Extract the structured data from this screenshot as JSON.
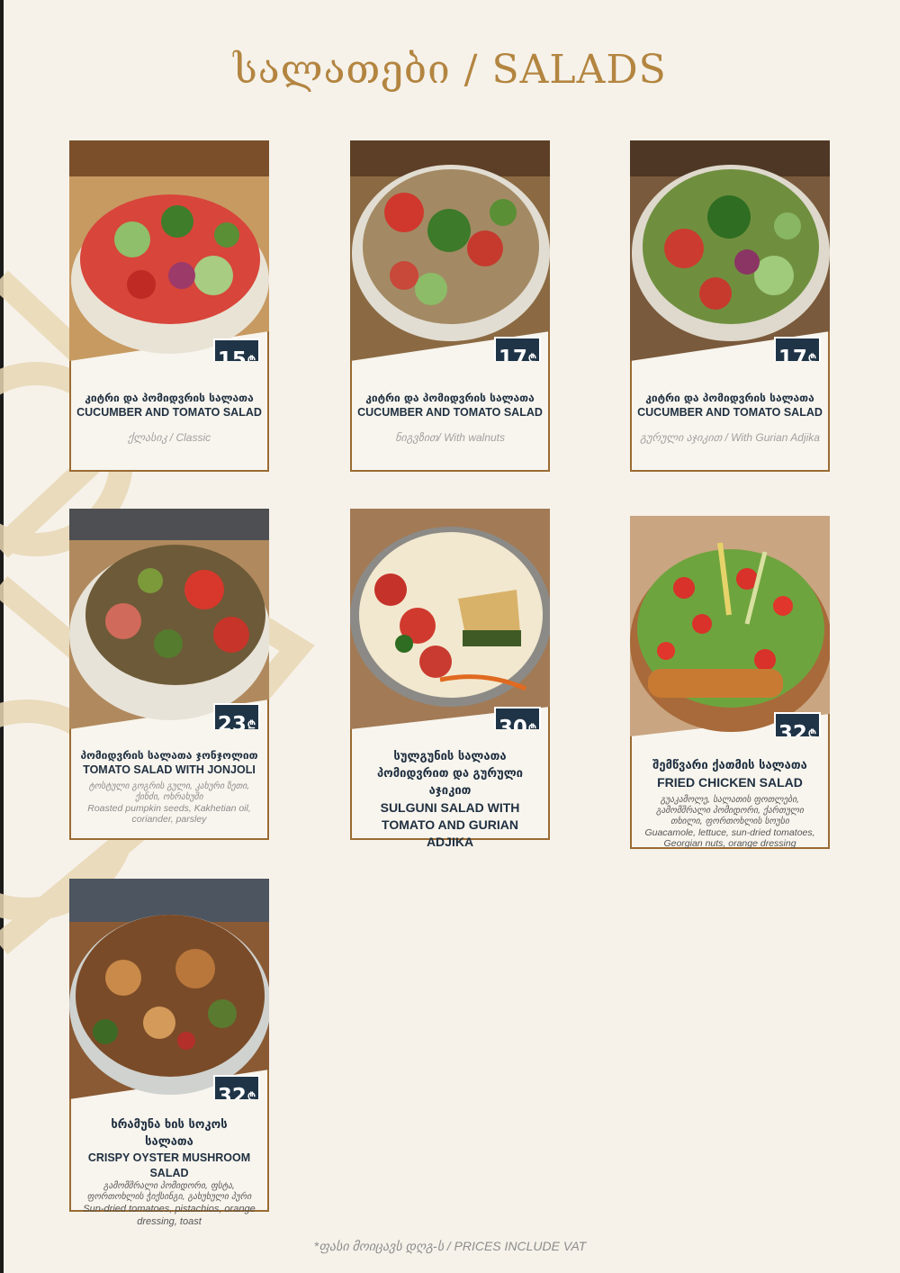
{
  "header": {
    "title": "სალათები / SALADS"
  },
  "currency_symbol": "₾",
  "colors": {
    "accent": "#b38540",
    "price_bg": "#1f3447",
    "border": "#9a6b32",
    "background": "#f6f2ea"
  },
  "items": [
    {
      "price": "15",
      "name_ka": "კიტრი და პომიდვრის სალათა",
      "name_en": "CUCUMBER AND TOMATO SALAD",
      "subtitle": "ქლასიკ / Classic"
    },
    {
      "price": "17",
      "name_ka": "კიტრი და პომიდვრის სალათა",
      "name_en": "CUCUMBER AND TOMATO SALAD",
      "subtitle": "ნიგვზით/ With walnuts"
    },
    {
      "price": "17",
      "name_ka": "კიტრი და პომიდვრის სალათა",
      "name_en": "CUCUMBER AND TOMATO SALAD",
      "subtitle": "გურული აჯიკით / With Gurian Adjika"
    },
    {
      "price": "23",
      "name_ka": "პომიდვრის სალათა ჯონჯოლით",
      "name_en": "TOMATO SALAD WITH JONJOLI",
      "desc_ka": "ტოსტული გოგრის გული, კახური ზეთი, ქინძი, ოხრახუში",
      "desc_en": "Roasted pumpkin seeds, Kakhetian oil, coriander, parsley"
    },
    {
      "price": "30",
      "name_ka": "სულგუნის სალათა პომიდვრით და გურული აჯიკით",
      "name_en": "SULGUNI SALAD WITH TOMATO AND GURIAN ADJIKA"
    },
    {
      "price": "32",
      "name_ka": "შემწვარი ქათმის სალათა",
      "name_en": "FRIED CHICKEN SALAD",
      "desc_ka": "გუაკამოლე, სალათის ფოთლები, გამომშრალი პომიდორი, ქართული თხილი, ფორთოხლის სოუსი",
      "desc_en": "Guacamole, lettuce, sun-dried tomatoes, Georgian nuts, orange dressing"
    },
    {
      "price": "32",
      "name_ka": "ხრამუნა ხის სოკოს სალათა",
      "name_en": "CRISPY OYSTER MUSHROOM SALAD",
      "desc_ka": "გამომშრალი პომიდორი, ფსტა, ფორთოხლის ჭიქსინგი, გახუხული პური",
      "desc_en": "Sun-dried tomatoes, pistachios, orange dressing, toast"
    }
  ],
  "footer": {
    "note": "*ფასი მოიცავს დღგ-ს / PRICES INCLUDE VAT"
  }
}
